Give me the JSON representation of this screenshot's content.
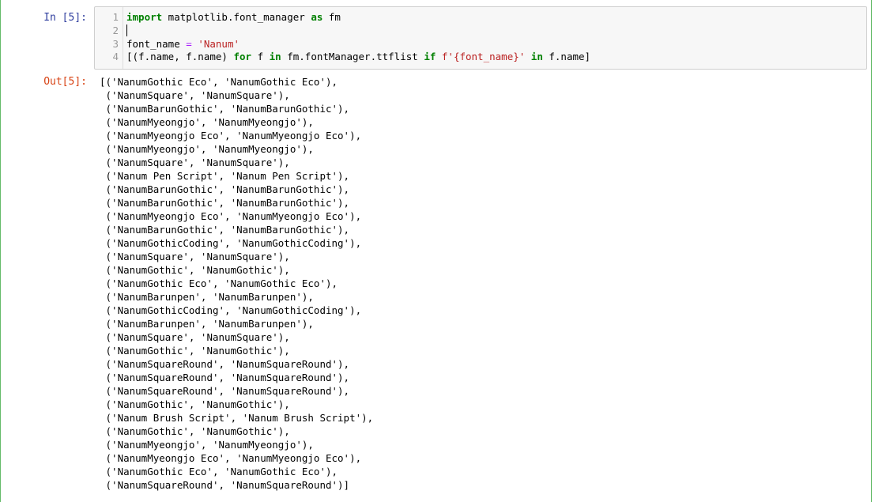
{
  "input_cell": {
    "prompt": "In [5]:",
    "line_numbers": [
      "1",
      "2",
      "3",
      "4"
    ],
    "lines": [
      [
        {
          "t": "import",
          "c": "kw"
        },
        {
          "t": " matplotlib.font_manager ",
          "c": ""
        },
        {
          "t": "as",
          "c": "kw"
        },
        {
          "t": " fm",
          "c": ""
        }
      ],
      [],
      [
        {
          "t": "font_name ",
          "c": ""
        },
        {
          "t": "=",
          "c": "op"
        },
        {
          "t": " ",
          "c": ""
        },
        {
          "t": "'Nanum'",
          "c": "str"
        }
      ],
      [
        {
          "t": "[(f.name, f.name) ",
          "c": ""
        },
        {
          "t": "for",
          "c": "kw"
        },
        {
          "t": " f ",
          "c": ""
        },
        {
          "t": "in",
          "c": "kw"
        },
        {
          "t": " fm.fontManager.ttflist ",
          "c": ""
        },
        {
          "t": "if",
          "c": "kw"
        },
        {
          "t": " ",
          "c": ""
        },
        {
          "t": "f'{font_name}'",
          "c": "str"
        },
        {
          "t": " ",
          "c": ""
        },
        {
          "t": "in",
          "c": "kw"
        },
        {
          "t": " f.name]",
          "c": ""
        }
      ]
    ]
  },
  "output_cell": {
    "prompt": "Out[5]:",
    "lines": [
      "[('NanumGothic Eco', 'NanumGothic Eco'),",
      " ('NanumSquare', 'NanumSquare'),",
      " ('NanumBarunGothic', 'NanumBarunGothic'),",
      " ('NanumMyeongjo', 'NanumMyeongjo'),",
      " ('NanumMyeongjo Eco', 'NanumMyeongjo Eco'),",
      " ('NanumMyeongjo', 'NanumMyeongjo'),",
      " ('NanumSquare', 'NanumSquare'),",
      " ('Nanum Pen Script', 'Nanum Pen Script'),",
      " ('NanumBarunGothic', 'NanumBarunGothic'),",
      " ('NanumBarunGothic', 'NanumBarunGothic'),",
      " ('NanumMyeongjo Eco', 'NanumMyeongjo Eco'),",
      " ('NanumBarunGothic', 'NanumBarunGothic'),",
      " ('NanumGothicCoding', 'NanumGothicCoding'),",
      " ('NanumSquare', 'NanumSquare'),",
      " ('NanumGothic', 'NanumGothic'),",
      " ('NanumGothic Eco', 'NanumGothic Eco'),",
      " ('NanumBarunpen', 'NanumBarunpen'),",
      " ('NanumGothicCoding', 'NanumGothicCoding'),",
      " ('NanumBarunpen', 'NanumBarunpen'),",
      " ('NanumSquare', 'NanumSquare'),",
      " ('NanumGothic', 'NanumGothic'),",
      " ('NanumSquareRound', 'NanumSquareRound'),",
      " ('NanumSquareRound', 'NanumSquareRound'),",
      " ('NanumSquareRound', 'NanumSquareRound'),",
      " ('NanumGothic', 'NanumGothic'),",
      " ('Nanum Brush Script', 'Nanum Brush Script'),",
      " ('NanumGothic', 'NanumGothic'),",
      " ('NanumMyeongjo', 'NanumMyeongjo'),",
      " ('NanumMyeongjo Eco', 'NanumMyeongjo Eco'),",
      " ('NanumGothic Eco', 'NanumGothic Eco'),",
      " ('NanumSquareRound', 'NanumSquareRound')]"
    ]
  },
  "colors": {
    "cell_border": "#66bb6a",
    "in_prompt": "#303f9f",
    "out_prompt": "#d84315",
    "keyword": "#008000",
    "string": "#ba2121",
    "operator": "#aa22ff"
  }
}
